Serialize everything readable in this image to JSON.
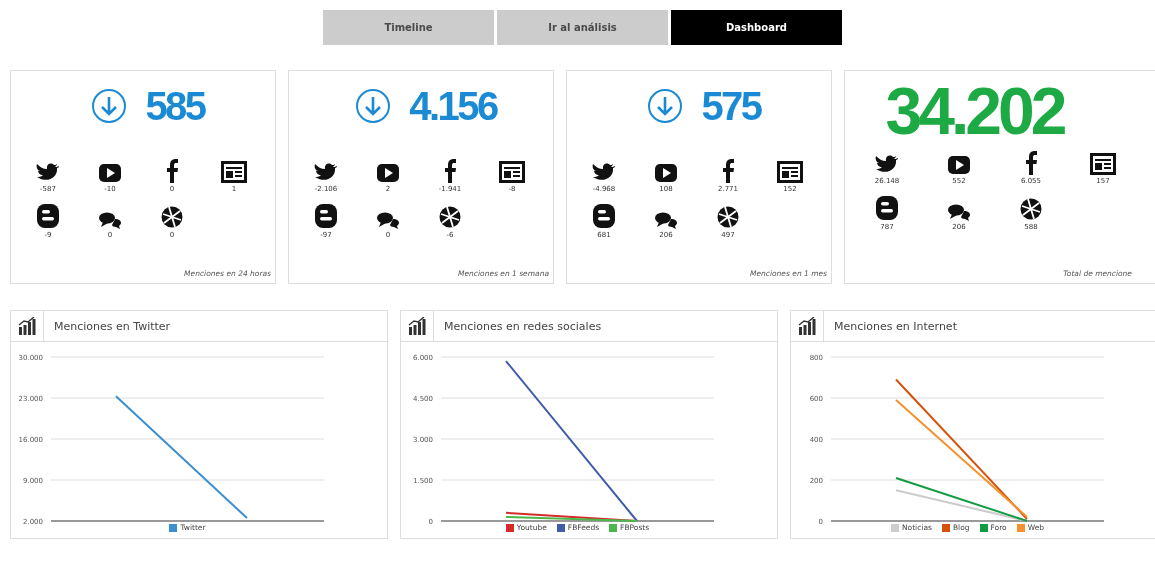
{
  "tabs": [
    {
      "label": "Timeline",
      "selected": false
    },
    {
      "label": "Ir al análisis",
      "selected": false
    },
    {
      "label": "Dashboard",
      "selected": true
    }
  ],
  "cards": [
    {
      "kind": "period",
      "total": "585",
      "footer": "Menciones en 24 horas",
      "stats": [
        {
          "kind": "twitter",
          "value": "-587"
        },
        {
          "kind": "youtube",
          "value": "-10"
        },
        {
          "kind": "facebook",
          "value": "0"
        },
        {
          "kind": "news",
          "value": "1"
        },
        {
          "kind": "blog",
          "value": "-9"
        },
        {
          "kind": "comments",
          "value": "0"
        },
        {
          "kind": "web",
          "value": "0"
        }
      ]
    },
    {
      "kind": "period",
      "total": "4.156",
      "footer": "Menciones en 1 semana",
      "stats": [
        {
          "kind": "twitter",
          "value": "-2.106"
        },
        {
          "kind": "youtube",
          "value": "2"
        },
        {
          "kind": "facebook",
          "value": "-1.941"
        },
        {
          "kind": "news",
          "value": "-8"
        },
        {
          "kind": "blog",
          "value": "-97"
        },
        {
          "kind": "comments",
          "value": "0"
        },
        {
          "kind": "web",
          "value": "-6"
        }
      ]
    },
    {
      "kind": "period",
      "total": "575",
      "footer": "Menciones en 1 mes",
      "stats": [
        {
          "kind": "twitter",
          "value": "-4.968"
        },
        {
          "kind": "youtube",
          "value": "108"
        },
        {
          "kind": "facebook",
          "value": "2.771"
        },
        {
          "kind": "news",
          "value": "152"
        },
        {
          "kind": "blog",
          "value": "681"
        },
        {
          "kind": "comments",
          "value": "206"
        },
        {
          "kind": "web",
          "value": "497"
        }
      ]
    },
    {
      "kind": "total",
      "total": "34.202",
      "footer": "Total de mencione",
      "stats": [
        {
          "kind": "twitter",
          "value": "26.148"
        },
        {
          "kind": "youtube",
          "value": "552"
        },
        {
          "kind": "facebook",
          "value": "6.055"
        },
        {
          "kind": "news",
          "value": "157"
        },
        {
          "kind": "blog",
          "value": "787"
        },
        {
          "kind": "comments",
          "value": "206"
        },
        {
          "kind": "web",
          "value": "588"
        }
      ]
    }
  ],
  "charts": [
    {
      "title": "Menciones en Twitter",
      "chart_data": {
        "type": "line",
        "grid": true,
        "legend": "bottom",
        "ylim": [
          2000,
          30000
        ],
        "yticks": [
          {
            "value": 2000,
            "label": "2.000"
          },
          {
            "value": 9000,
            "label": "9.000"
          },
          {
            "value": 16000,
            "label": "16.000"
          },
          {
            "value": 23000,
            "label": "23.000"
          },
          {
            "value": 30000,
            "label": "30.000"
          }
        ],
        "series": [
          {
            "name": "Twitter",
            "color": "#3a8fd0",
            "values": [
              23300,
              2500
            ]
          }
        ]
      }
    },
    {
      "title": "Menciones en redes sociales",
      "chart_data": {
        "type": "line",
        "grid": true,
        "legend": "bottom",
        "ylim": [
          0,
          6000
        ],
        "yticks": [
          {
            "value": 0,
            "label": "0"
          },
          {
            "value": 1500,
            "label": "1.500"
          },
          {
            "value": 3000,
            "label": "3.000"
          },
          {
            "value": 4500,
            "label": "4.500"
          },
          {
            "value": 6000,
            "label": "6.000"
          }
        ],
        "series": [
          {
            "name": "Youtube",
            "color": "#d42a2a",
            "values": [
              300,
              0
            ]
          },
          {
            "name": "FBFeeds",
            "color": "#3f5ba9",
            "values": [
              5850,
              0
            ]
          },
          {
            "name": "FBPosts",
            "color": "#4cb84c",
            "values": [
              150,
              0
            ]
          }
        ]
      }
    },
    {
      "title": "Menciones en Internet",
      "chart_data": {
        "type": "line",
        "grid": true,
        "legend": "bottom",
        "ylim": [
          0,
          800
        ],
        "yticks": [
          {
            "value": 0,
            "label": "0"
          },
          {
            "value": 200,
            "label": "200"
          },
          {
            "value": 400,
            "label": "400"
          },
          {
            "value": 600,
            "label": "600"
          },
          {
            "value": 800,
            "label": "800"
          }
        ],
        "series": [
          {
            "name": "Noticias",
            "color": "#cccccc",
            "values": [
              150,
              0
            ]
          },
          {
            "name": "Blog",
            "color": "#d4520a",
            "values": [
              690,
              10
            ]
          },
          {
            "name": "Foro",
            "color": "#159a44",
            "values": [
              210,
              0
            ]
          },
          {
            "name": "Web",
            "color": "#f5912e",
            "values": [
              590,
              20
            ]
          }
        ]
      }
    }
  ]
}
